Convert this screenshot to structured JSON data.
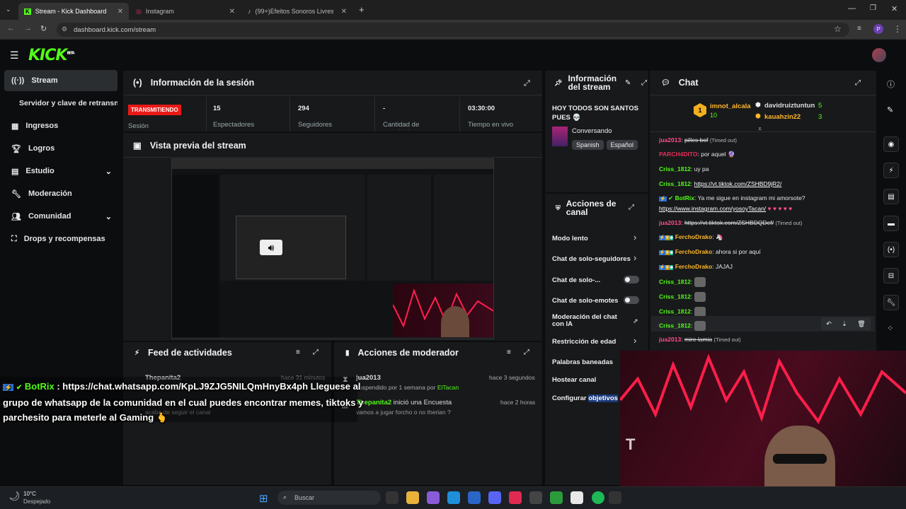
{
  "browser": {
    "tabs": [
      {
        "label": "Stream - Kick Dashboard"
      },
      {
        "label": "Instagram"
      },
      {
        "label": "(99+)Efeitos Sonoros Livres pa"
      }
    ],
    "url": "dashboard.kick.com/stream",
    "profile_initial": "P"
  },
  "sidebar": {
    "items": [
      {
        "label": "Stream"
      },
      {
        "label": "Servidor y clave de retransn"
      },
      {
        "label": "Ingresos"
      },
      {
        "label": "Logros"
      },
      {
        "label": "Estudio"
      },
      {
        "label": "Moderación"
      },
      {
        "label": "Comunidad"
      },
      {
        "label": "Drops y recompensas"
      }
    ]
  },
  "session": {
    "title": "Información de la sesión",
    "status_badge": "TRANSMITIENDO",
    "status_label": "Sesión",
    "stats": [
      {
        "value": "15",
        "label": "Espectadores"
      },
      {
        "value": "294",
        "label": "Seguidores"
      },
      {
        "value": "-",
        "label": "Cantidad de suscripciones"
      },
      {
        "value": "03:30:00",
        "label": "Tiempo en vivo"
      }
    ]
  },
  "preview": {
    "title": "Vista previa del stream"
  },
  "stream_info": {
    "title": "Información del stream",
    "stream_title": "HOY TODOS SON SANTOS PUES 💀",
    "category": "Conversando",
    "tags": [
      "Spanish",
      "Español"
    ]
  },
  "channel_actions": {
    "title": "Acciones de canal",
    "items": [
      {
        "label": "Modo lento"
      },
      {
        "label": "Chat de solo-seguidores"
      },
      {
        "label": "Chat de solo-..."
      },
      {
        "label": "Chat de solo-emotes"
      },
      {
        "label": "Moderación del chat con IA"
      },
      {
        "label": "Restricción de edad"
      },
      {
        "label": "Palabras baneadas"
      },
      {
        "label": "Hostear canal"
      },
      {
        "label": "Configurar",
        "highlight": "objetivos"
      }
    ]
  },
  "chat": {
    "title": "Chat",
    "leaderboard": [
      {
        "name": "imnot_alcala",
        "count": "10",
        "rank": "1"
      },
      {
        "name": "davidruiztuntun",
        "count": "5"
      },
      {
        "name": "kauahzin22",
        "count": "3"
      }
    ],
    "messages": [
      {
        "user": "jua2013",
        "sep": ": ",
        "text": "pilles bof",
        "extra": "(Timed out)"
      },
      {
        "user": "PARCH4DITO",
        "sep": ": ",
        "text": "por aquel 🔮"
      },
      {
        "user": "Criss_1812",
        "sep": ": ",
        "text": "uy pa"
      },
      {
        "user": "Criss_1812",
        "sep": ": ",
        "text": "https://vt.tiktok.com/ZSHBD9jR2/"
      },
      {
        "user": "BotRix",
        "sep": ": ",
        "text": "Ya me sigue en instagram mi amorsote?",
        "text2": "https://www.instagram.com/yosoyTacan/",
        "hearts": "♥ ♥ ♥ ♥ ♥"
      },
      {
        "user": "jua2013",
        "sep": ": ",
        "text": "https://vt.tiktok.com/ZSHBDQDef/",
        "extra": "(Timed out)"
      },
      {
        "user": "FerchoDrako",
        "sep": ": ",
        "text": "🦄"
      },
      {
        "user": "FerchoDrako",
        "sep": ": ",
        "text": "ahora si por aquí"
      },
      {
        "user": "FerchoDrako",
        "sep": ": ",
        "text": "JAJAJ"
      },
      {
        "user": "Criss_1812",
        "sep": ": ",
        "text": ""
      },
      {
        "user": "Criss_1812",
        "sep": ": ",
        "text": ""
      },
      {
        "user": "Criss_1812",
        "sep": ": ",
        "text": ""
      },
      {
        "user": "Criss_1812",
        "sep": ": ",
        "text": ""
      },
      {
        "user": "jua2013",
        "sep": ": ",
        "text": "mire lamia",
        "extra": "(Timed out)"
      }
    ]
  },
  "activity": {
    "title": "Feed de actividades",
    "items": [
      {
        "user": "Thepanita2",
        "time": "hace 31 minutos",
        "text": "acaba de seguir el canal"
      }
    ]
  },
  "mod_actions": {
    "title": "Acciones de moderador",
    "items": [
      {
        "user": "jua2013",
        "time": "hace 3 segundos",
        "text": "suspendido por 1 semana por",
        "by": "ElTacan"
      },
      {
        "user": "Thepanita2",
        "action": "inició una Encuesta",
        "time": "hace 2 horas",
        "text": "vamos a jugar forcho o no therian ?"
      }
    ]
  },
  "overlay": {
    "user": "BotRix",
    "text": " : https://chat.whatsapp.com/KpLJ9ZJG5NILQmHnyBx4ph Lleguese al grupo de whatsapp de la comunidad en el cual puedes encontrar memes, tiktoks y parchesito para meterle al Gaming 🫰"
  },
  "taskbar": {
    "weather_temp": "10°C",
    "weather_desc": "Despejado",
    "search_placeholder": "Buscar"
  },
  "colors": {
    "kick_green": "#53fc18",
    "badge_red": "#e91916",
    "panel": "#18191b"
  }
}
